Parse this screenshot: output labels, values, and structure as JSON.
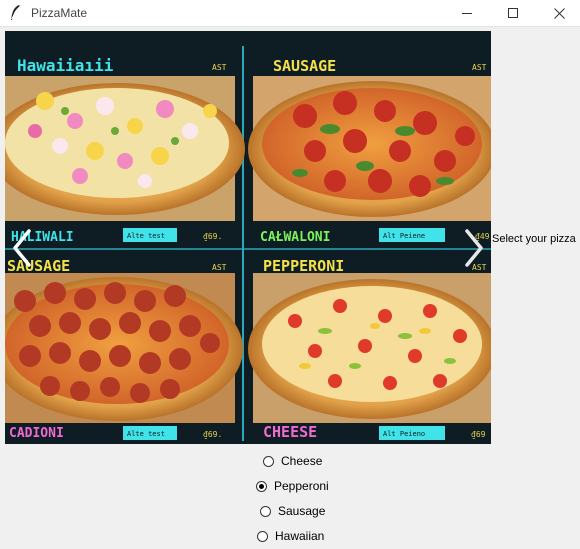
{
  "window": {
    "title": "PizzaMate",
    "minimize_icon": "minimize-icon",
    "maximize_icon": "maximize-icon",
    "close_icon": "close-icon"
  },
  "image": {
    "panels": [
      {
        "top_label": "Hawaiiaıii",
        "bottom_label": "HALIWALI",
        "badge": "AST",
        "alt_text": "Alte test",
        "price": "₫69."
      },
      {
        "top_label": "SAUSAGE",
        "bottom_label": "CAŁWALONI",
        "badge": "AST",
        "alt_text": "Alt Peiene",
        "price": "₫49"
      },
      {
        "top_label": "SAUSAGE",
        "bottom_label": "CADIONI",
        "badge": "AST",
        "alt_text": "Alte test",
        "price": "₫69."
      },
      {
        "top_label": "PEPPERONI",
        "bottom_label": "CHEESE",
        "badge": "AST",
        "alt_text": "Alt Peieno",
        "price": "₫69"
      }
    ],
    "prev_icon": "chevron-left-icon",
    "next_icon": "chevron-right-icon"
  },
  "instruction": "Select your pizza",
  "options": [
    {
      "label": "Cheese",
      "checked": false
    },
    {
      "label": "Pepperoni",
      "checked": true
    },
    {
      "label": "Sausage",
      "checked": false
    },
    {
      "label": "Hawaiian",
      "checked": false
    }
  ]
}
